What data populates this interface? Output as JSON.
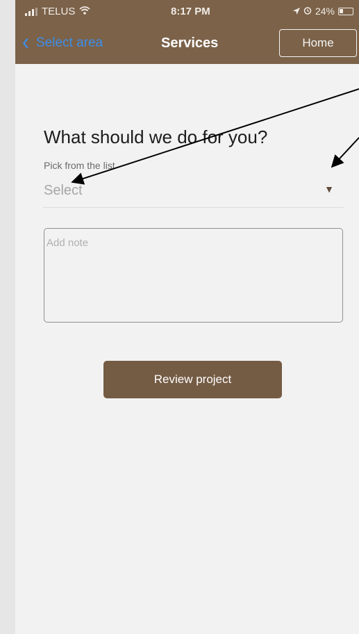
{
  "status_bar": {
    "carrier": "TELUS",
    "time": "8:17 PM",
    "battery": "24%"
  },
  "nav": {
    "back_label": "Select area",
    "title": "Services",
    "home_label": "Home"
  },
  "form": {
    "question": "What should we do for you?",
    "pick_label": "Pick from the list",
    "dropdown_value": "Select",
    "note_placeholder": "Add note",
    "review_label": "Review project"
  },
  "colors": {
    "header_bg": "#7b6249",
    "button_bg": "#745b44",
    "link_blue": "#3f8ee8"
  },
  "icons": [
    "signal-icon",
    "wifi-icon",
    "location-icon",
    "alarm-icon",
    "battery-icon",
    "chevron-left-icon",
    "caret-down-icon"
  ]
}
